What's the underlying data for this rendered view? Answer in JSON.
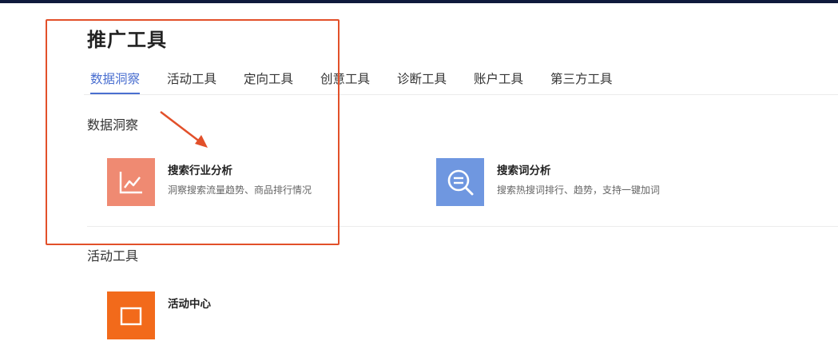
{
  "page": {
    "title": "推广工具"
  },
  "tabs": [
    {
      "label": "数据洞察",
      "active": true
    },
    {
      "label": "活动工具",
      "active": false
    },
    {
      "label": "定向工具",
      "active": false
    },
    {
      "label": "创意工具",
      "active": false
    },
    {
      "label": "诊断工具",
      "active": false
    },
    {
      "label": "账户工具",
      "active": false
    },
    {
      "label": "第三方工具",
      "active": false
    }
  ],
  "sections": [
    {
      "title": "数据洞察",
      "tools": [
        {
          "name": "搜索行业分析",
          "desc": "洞察搜索流量趋势、商品排行情况",
          "icon": "line-chart-icon",
          "color": "#ef8a72"
        },
        {
          "name": "搜索词分析",
          "desc": "搜索热搜词排行、趋势，支持一键加词",
          "icon": "search-word-icon",
          "color": "#6f97e0"
        }
      ]
    },
    {
      "title": "活动工具",
      "tools": [
        {
          "name": "活动中心",
          "icon": "activity-icon",
          "color": "#f26a1b"
        }
      ]
    }
  ],
  "annotation": {
    "color": "#e2502a"
  }
}
